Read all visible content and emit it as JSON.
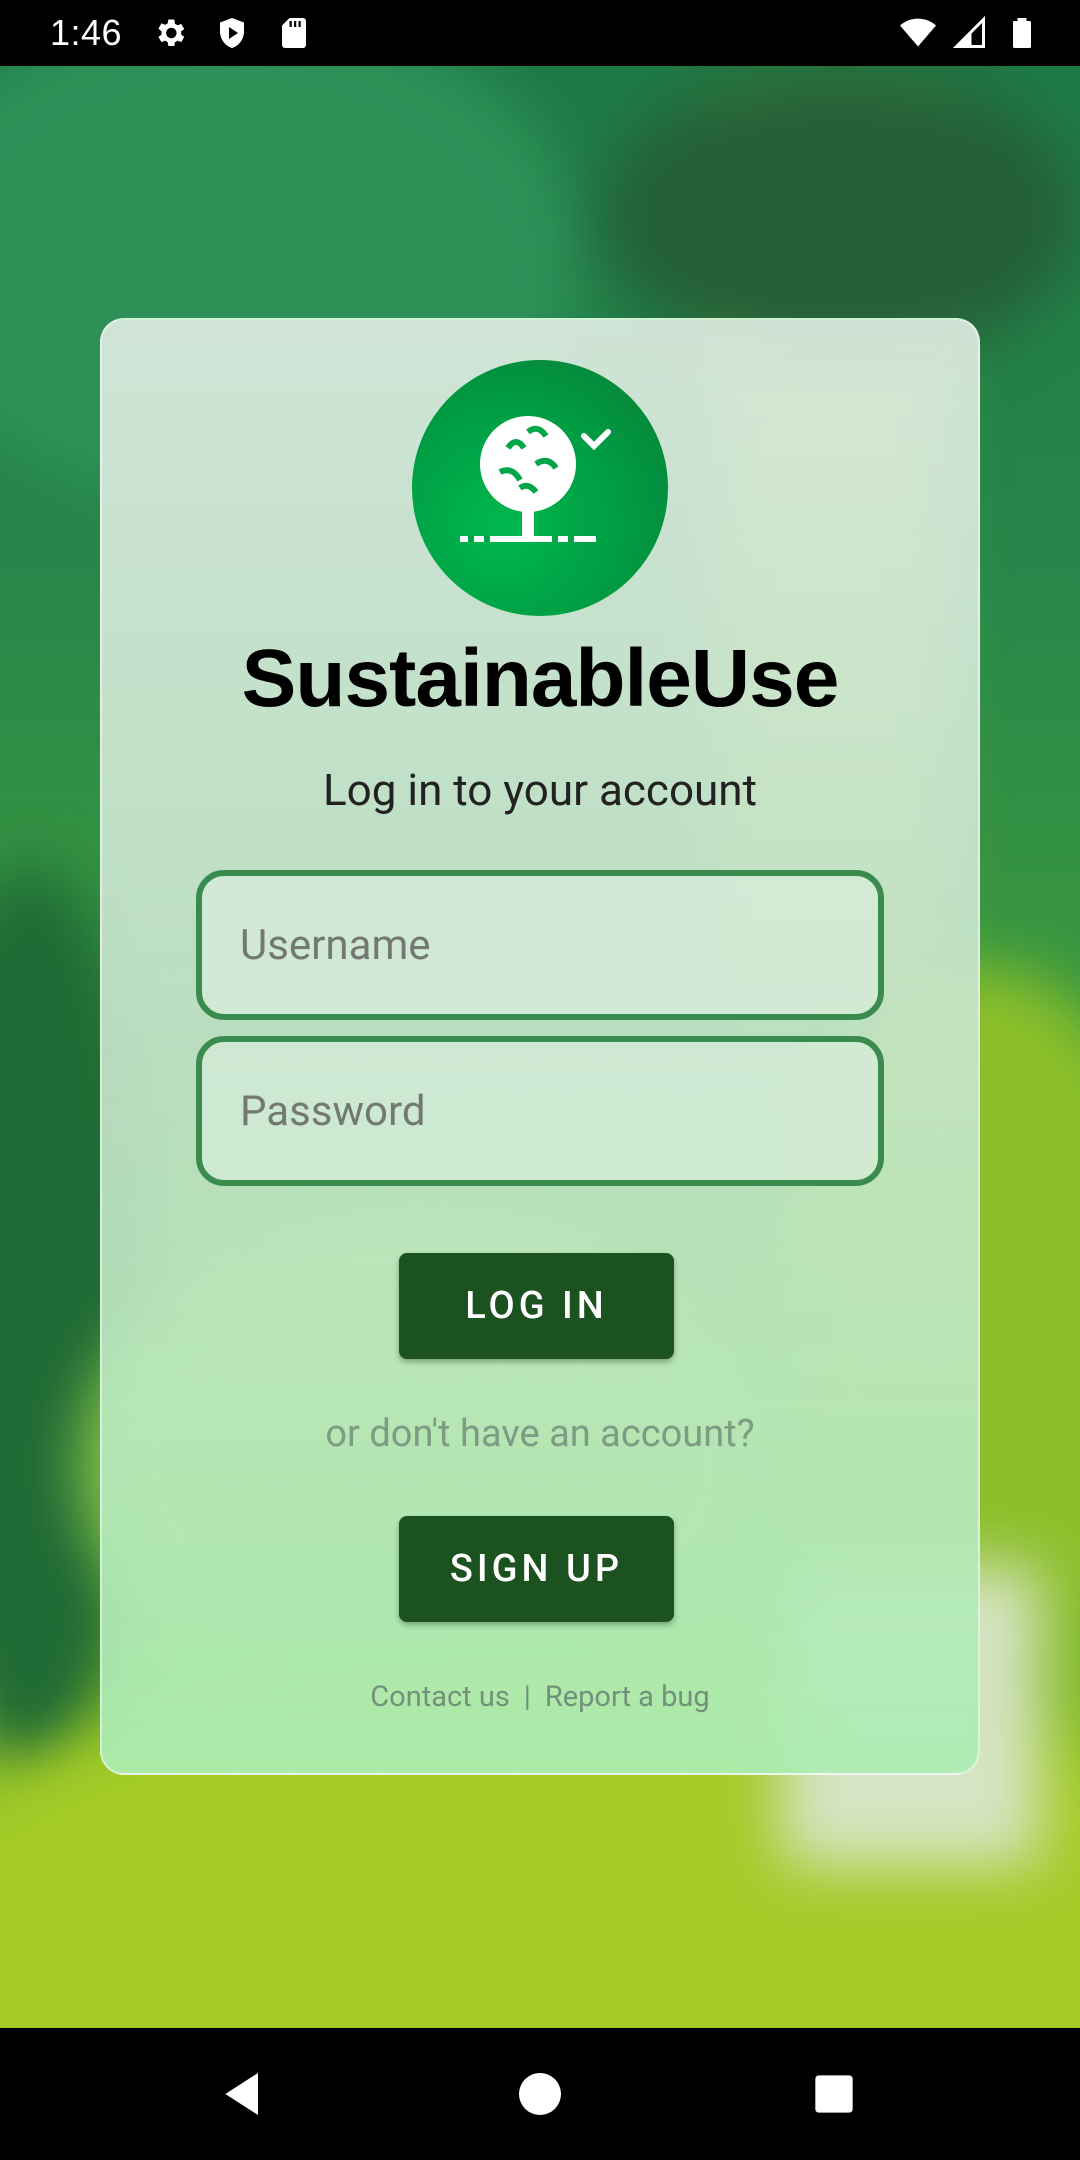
{
  "status_bar": {
    "time": "1:46",
    "left_icons": [
      "settings-gear-icon",
      "shield-play-icon",
      "sd-card-icon"
    ],
    "right_icons": [
      "wifi-icon",
      "cell-signal-icon",
      "battery-icon"
    ]
  },
  "app": {
    "title": "SustainableUse",
    "subtitle": "Log in to your account",
    "logo_icon": "tree-logo-icon"
  },
  "form": {
    "username_placeholder": "Username",
    "password_placeholder": "Password",
    "login_label": "LOG IN",
    "alt_prompt": "or don't have an account?",
    "signup_label": "SIGN UP"
  },
  "footer": {
    "contact_label": "Contact us",
    "separator": "|",
    "report_label": "Report a bug"
  },
  "colors": {
    "button_bg": "#1b521f",
    "field_border": "#3a8c4e",
    "logo_green": "#009a42"
  },
  "nav_bar": {
    "icons": [
      "back-triangle-icon",
      "home-circle-icon",
      "recents-square-icon"
    ]
  }
}
